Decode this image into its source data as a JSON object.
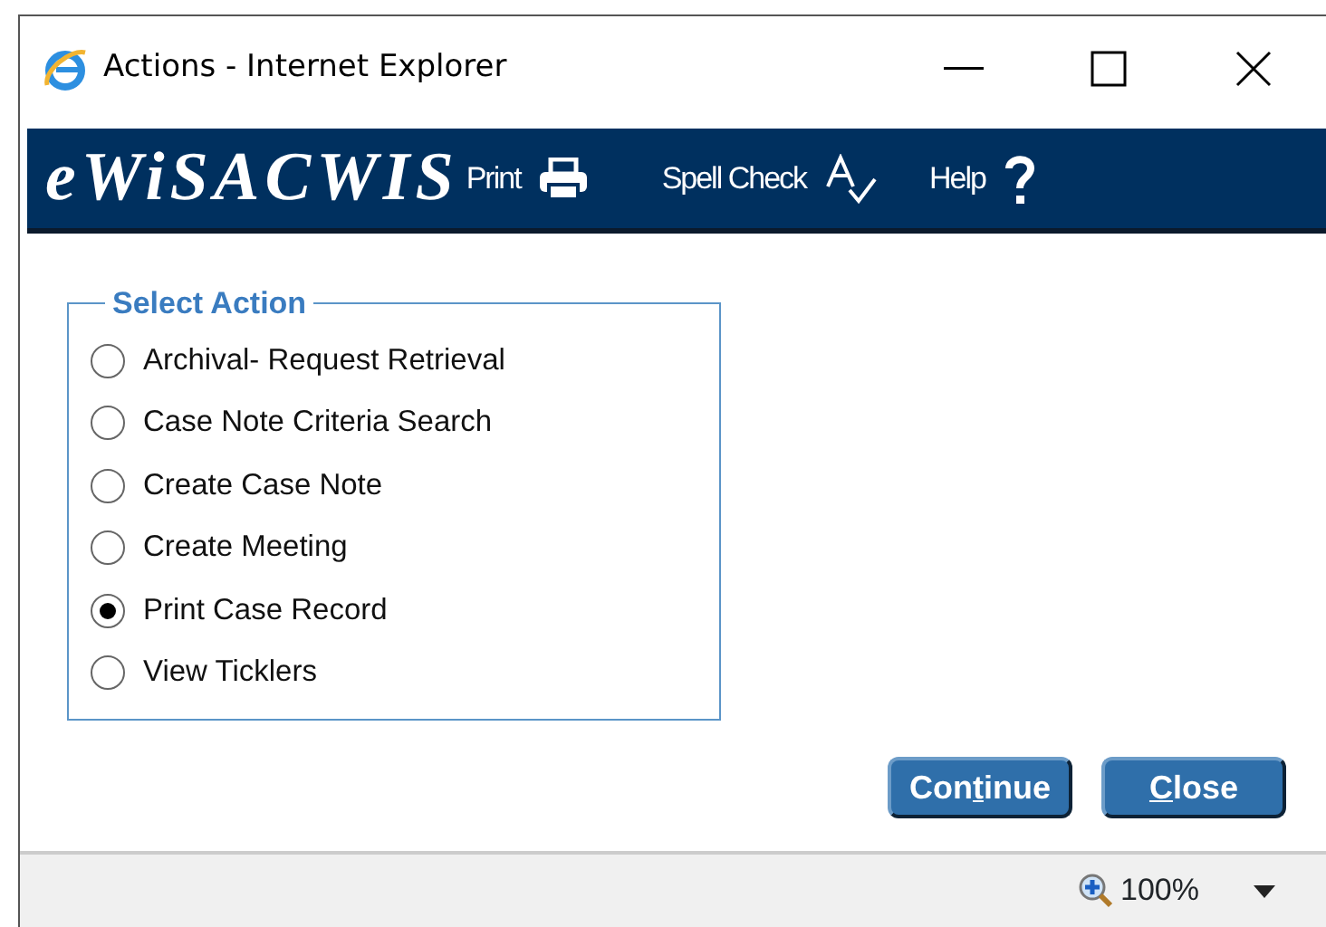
{
  "window": {
    "title": "Actions - Internet Explorer"
  },
  "banner": {
    "logo": "eWiSACWIS",
    "tools": [
      {
        "kind": "print",
        "label": "Print"
      },
      {
        "kind": "spell",
        "label": "Spell Check"
      },
      {
        "kind": "help",
        "label": "Help"
      }
    ]
  },
  "fieldset": {
    "legend": "Select Action",
    "options": [
      {
        "label": "Archival- Request Retrieval",
        "selected": false
      },
      {
        "label": "Case Note Criteria Search",
        "selected": false
      },
      {
        "label": "Create Case Note",
        "selected": false
      },
      {
        "label": "Create Meeting",
        "selected": false
      },
      {
        "label": "Print Case Record",
        "selected": true
      },
      {
        "label": "View Ticklers",
        "selected": false
      }
    ]
  },
  "buttons": [
    {
      "before_key": "Con",
      "access_key": "t",
      "after_key": "inue"
    },
    {
      "access_key": "C",
      "after_key": "lose"
    }
  ],
  "status_bar": {
    "zoom": "100%"
  }
}
